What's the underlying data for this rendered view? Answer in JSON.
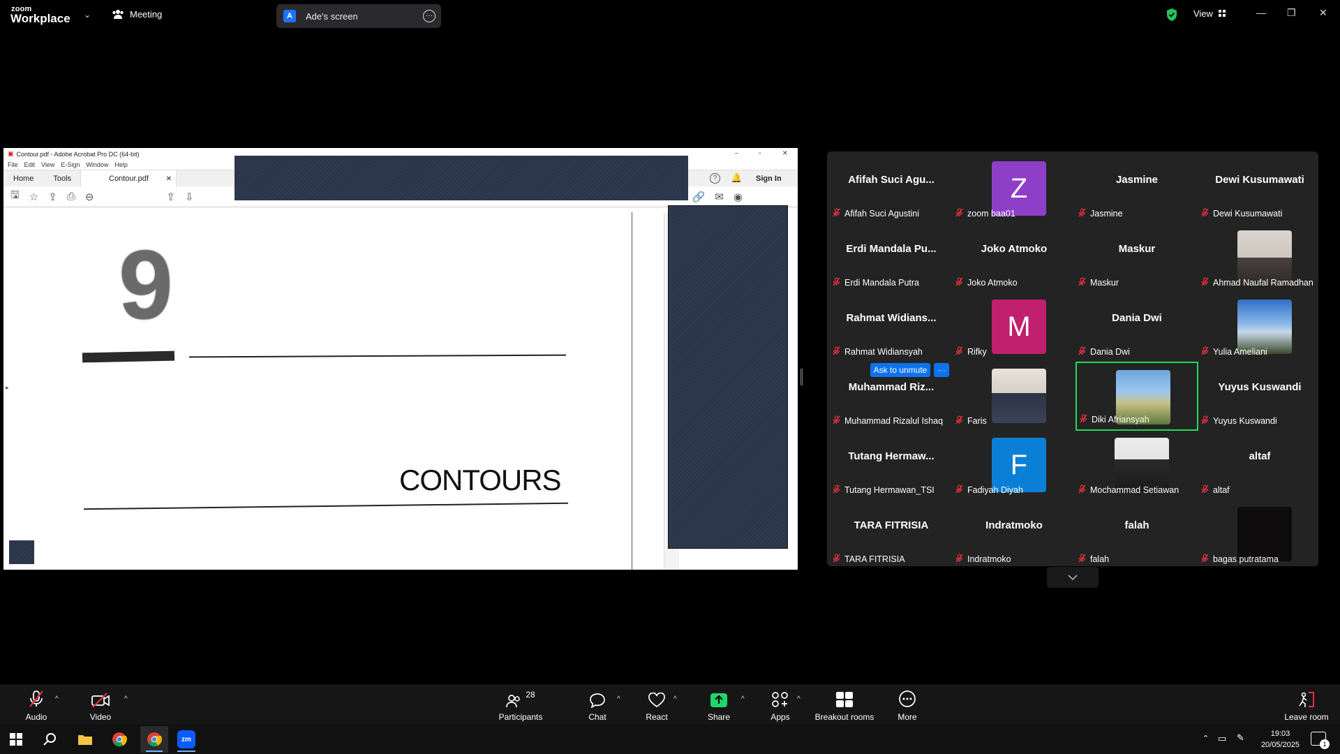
{
  "app": {
    "logo_top": "zoom",
    "logo_bottom": "Workplace",
    "meeting_label": "Meeting",
    "screen_badge": "A",
    "screen_label": "Ade's screen",
    "view_label": "View"
  },
  "acrobat": {
    "window_title": "Contour.pdf - Adobe Acrobat Pro DC (64-bit)",
    "menu": [
      "File",
      "Edit",
      "View",
      "E-Sign",
      "Window",
      "Help"
    ],
    "tabs": {
      "home": "Home",
      "tools": "Tools",
      "doc": "Contour.pdf"
    },
    "sign_in": "Sign In",
    "page": {
      "chapter_number": "9",
      "chapter_title": "CONTOURS"
    }
  },
  "participants": [
    {
      "big": "Afifah Suci Agu...",
      "name": "Afifah Suci Agustini",
      "type": "name"
    },
    {
      "big": "Z",
      "name": "zoom baa01",
      "type": "letter",
      "color": "#8e3fc7"
    },
    {
      "big": "Jasmine",
      "name": "Jasmine",
      "type": "name"
    },
    {
      "big": "Dewi Kusumawati",
      "name": "Dewi Kusumawati",
      "type": "name"
    },
    {
      "big": "Erdi Mandala Pu...",
      "name": "Erdi Mandala Putra",
      "type": "name"
    },
    {
      "big": "Joko Atmoko",
      "name": "Joko Atmoko",
      "type": "name"
    },
    {
      "big": "Maskur",
      "name": "Maskur",
      "type": "name"
    },
    {
      "big": "",
      "name": "Ahmad Naufal Ramadhan",
      "type": "photo",
      "photo": "person"
    },
    {
      "big": "Rahmat Widians...",
      "name": "Rahmat Widiansyah",
      "type": "name"
    },
    {
      "big": "M",
      "name": "Rifky",
      "type": "letter",
      "color": "#c0206f"
    },
    {
      "big": "Dania Dwi",
      "name": "Dania Dwi",
      "type": "name"
    },
    {
      "big": "",
      "name": "Yulia Ameliani",
      "type": "photo",
      "photo": "sky"
    },
    {
      "big": "Muhammad Riz...",
      "name": "Muhammad Rizalul Ishaq",
      "type": "name"
    },
    {
      "big": "",
      "name": "Faris",
      "type": "photo",
      "photo": "person2"
    },
    {
      "big": "",
      "name": "Diki Afriansyah",
      "type": "photo",
      "photo": "field",
      "active": true
    },
    {
      "big": "Yuyus Kuswandi",
      "name": "Yuyus Kuswandi",
      "type": "name"
    },
    {
      "big": "Tutang Hermaw...",
      "name": "Tutang Hermawan_TSI",
      "type": "name"
    },
    {
      "big": "F",
      "name": "Fadiyah Diyah",
      "type": "letter",
      "color": "#0b7fd6"
    },
    {
      "big": "",
      "name": "Mochammad Setiawan",
      "type": "photo",
      "photo": "person3"
    },
    {
      "big": "altaf",
      "name": "altaf",
      "type": "name"
    },
    {
      "big": "TARA FITRISIA",
      "name": "TARA FITRISIA",
      "type": "name"
    },
    {
      "big": "Indratmoko",
      "name": "Indratmoko",
      "type": "name"
    },
    {
      "big": "falah",
      "name": "falah",
      "type": "name"
    },
    {
      "big": "",
      "name": "bagas putratama",
      "type": "photo",
      "photo": "dark"
    }
  ],
  "ask_to_unmute": "Ask to unmute",
  "ask_more": "···",
  "toolbar": {
    "audio": "Audio",
    "video": "Video",
    "participants": "Participants",
    "participants_count": "28",
    "chat": "Chat",
    "react": "React",
    "share": "Share",
    "apps": "Apps",
    "breakout": "Breakout rooms",
    "more": "More",
    "leave": "Leave room"
  },
  "taskbar": {
    "time": "19:03",
    "date": "20/05/2025",
    "notif_count": "1"
  },
  "colors": {
    "accent_blue": "#0e72ed",
    "share_green": "#1fd86a",
    "mic_off_red": "#e0303a",
    "active_speaker": "#23d959"
  }
}
